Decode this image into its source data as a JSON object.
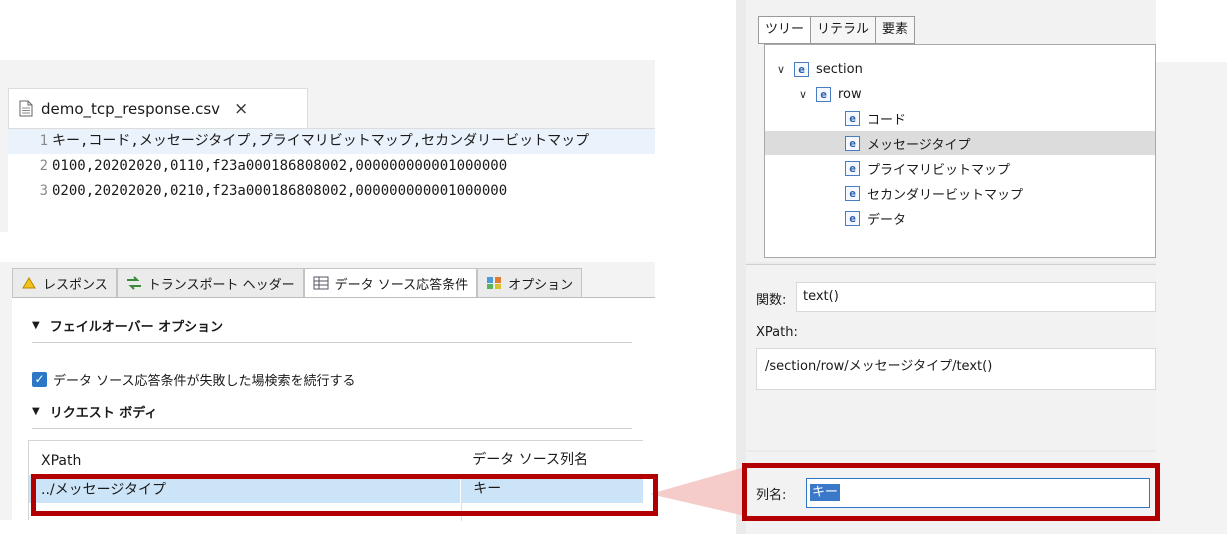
{
  "editor": {
    "filename": "demo_tcp_response.csv",
    "close_symbol": "×",
    "lines": [
      {
        "n": "1",
        "text": "キー,コード,メッセージタイプ,プライマリビットマップ,セカンダリービットマップ"
      },
      {
        "n": "2",
        "text": "0100,20202020,0110,f23a000186808002,000000000001000000"
      },
      {
        "n": "3",
        "text": "0200,20202020,0210,f23a000186808002,000000000001000000"
      }
    ]
  },
  "panel": {
    "tabs": [
      {
        "label": "レスポンス",
        "icon": "response-icon"
      },
      {
        "label": "トランスポート ヘッダー",
        "icon": "transport-icon"
      },
      {
        "label": "データ ソース応答条件",
        "icon": "datasource-icon",
        "active": true
      },
      {
        "label": "オプション",
        "icon": "options-icon"
      }
    ],
    "failover_title": "フェイルオーバー オプション",
    "checkbox_label": "データ ソース応答条件が失敗した場検索を続行する",
    "checkbox_checked": true,
    "request_body_title": "リクエスト ボディ",
    "grid": {
      "headers": [
        "XPath",
        "データ ソース列名"
      ],
      "row": [
        "../メッセージタイプ",
        "キー"
      ]
    }
  },
  "right": {
    "tabs": [
      "ツリー",
      "リテラル",
      "要素"
    ],
    "active_tab": "ツリー",
    "tree": [
      {
        "label": "section",
        "level": 0,
        "expanded": true
      },
      {
        "label": "row",
        "level": 1,
        "expanded": true
      },
      {
        "label": "コード",
        "level": 2
      },
      {
        "label": "メッセージタイプ",
        "level": 2,
        "selected": true
      },
      {
        "label": "プライマリビットマップ",
        "level": 2
      },
      {
        "label": "セカンダリービットマップ",
        "level": 2
      },
      {
        "label": "データ",
        "level": 2
      }
    ],
    "element_icon_letter": "e",
    "function_label": "関数:",
    "function_value": "text()",
    "xpath_label": "XPath:",
    "xpath_value": "/section/row/メッセージタイプ/text()",
    "column_label": "列名:",
    "column_value": "キー"
  },
  "colors": {
    "highlight": "#b20000",
    "selection": "#cce4f7",
    "callout": "#f4c7c3"
  }
}
